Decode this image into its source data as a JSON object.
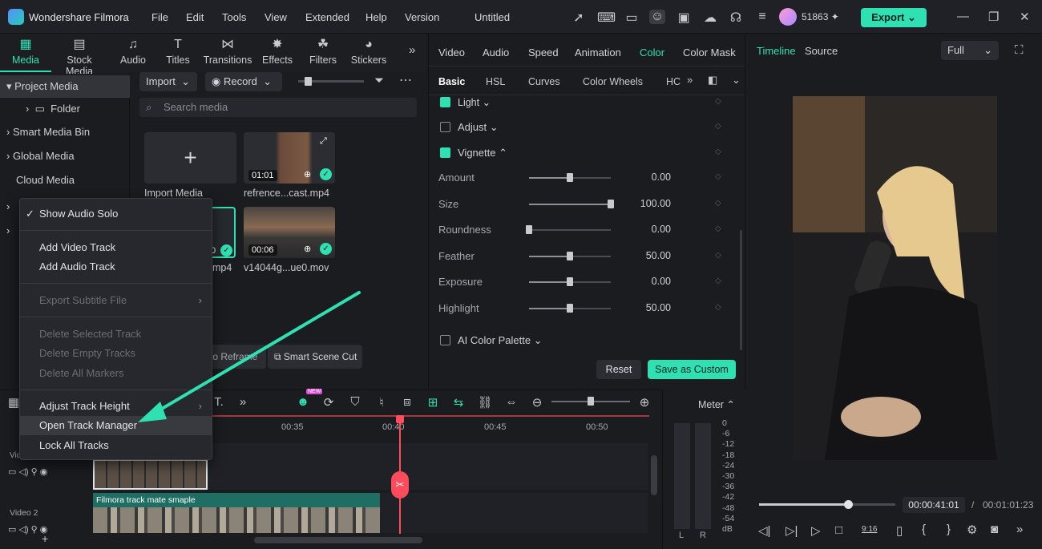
{
  "app": {
    "name": "Wondershare Filmora",
    "project_title": "Untitled",
    "credits": "51863",
    "export_label": "Export"
  },
  "menu": [
    "File",
    "Edit",
    "Tools",
    "View",
    "Extended",
    "Help",
    "Version"
  ],
  "media_tabs": [
    "Media",
    "Stock Media",
    "Audio",
    "Titles",
    "Transitions",
    "Effects",
    "Filters",
    "Stickers"
  ],
  "tree": {
    "project_media": "Project Media",
    "folder": "Folder",
    "smart_bin": "Smart Media Bin",
    "global_media": "Global Media",
    "cloud_media": "Cloud Media"
  },
  "media_toolbar": {
    "import_label": "Import",
    "record_label": "Record",
    "search_placeholder": "Search media"
  },
  "media_items": [
    {
      "label": "Import Media"
    },
    {
      "label": "refrence...cast.mp4",
      "duration": "01:01"
    },
    {
      "label": "mp4",
      "duration": "0"
    },
    {
      "label": "v14044g...ue0.mov",
      "duration": "00:06"
    }
  ],
  "media_bottom": {
    "auto_reframe": "to Reframe",
    "smart_scene_cut": "Smart Scene Cut"
  },
  "context_menu": {
    "show_audio_solo": "Show Audio Solo",
    "add_video_track": "Add Video Track",
    "add_audio_track": "Add Audio Track",
    "export_subtitle": "Export Subtitle File",
    "delete_selected": "Delete Selected Track",
    "delete_empty": "Delete Empty Tracks",
    "delete_markers": "Delete All Markers",
    "adjust_height": "Adjust Track Height",
    "open_manager": "Open Track Manager",
    "lock_all": "Lock All Tracks"
  },
  "props": {
    "tabs": [
      "Video",
      "Audio",
      "Speed",
      "Animation",
      "Color",
      "Color Mask"
    ],
    "subtabs": [
      "Basic",
      "HSL",
      "Curves",
      "Color Wheels",
      "HC"
    ],
    "light": "Light",
    "adjust": "Adjust",
    "vignette": "Vignette",
    "ai_palette": "AI Color Palette",
    "sliders": [
      {
        "label": "Amount",
        "value": "0.00",
        "level": 0.5
      },
      {
        "label": "Size",
        "value": "100.00",
        "level": 1.0
      },
      {
        "label": "Roundness",
        "value": "0.00",
        "level": 0.0
      },
      {
        "label": "Feather",
        "value": "50.00",
        "level": 0.5
      },
      {
        "label": "Exposure",
        "value": "0.00",
        "level": 0.5
      },
      {
        "label": "Highlight",
        "value": "50.00",
        "level": 0.5
      }
    ],
    "reset": "Reset",
    "save_custom": "Save as Custom"
  },
  "preview": {
    "tab_timeline": "Timeline",
    "tab_source": "Source",
    "quality": "Full",
    "current_time": "00:00:41:01",
    "separator": "/",
    "total_time": "00:01:01:23",
    "progress": 0.65
  },
  "timeline": {
    "ruler": [
      "00:35",
      "00:40",
      "00:45",
      "00:50"
    ],
    "tracks": {
      "video1_label": "Vide",
      "video2_label": "Video 2",
      "clip_name": "Filmora track mate smaple"
    },
    "meter_label": "Meter",
    "db_scale": [
      "0",
      "-6",
      "-12",
      "-18",
      "-24",
      "-30",
      "-36",
      "-42",
      "-48",
      "-54",
      "dB"
    ],
    "lr": [
      "L",
      "R"
    ],
    "new_badge": "NEW"
  }
}
